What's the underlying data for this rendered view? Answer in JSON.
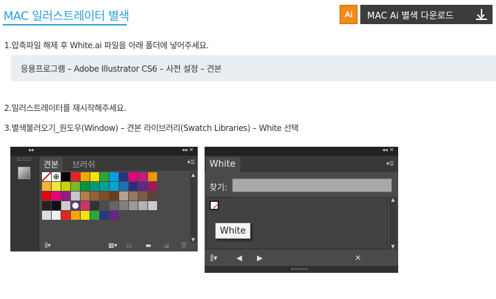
{
  "header": {
    "title": "MAC 일러스트레이터 별색",
    "download_badge": "Ai",
    "download_label": "MAC Ai 별색 다운로드"
  },
  "steps": {
    "step1": "1.압축파일 해제 후 White.ai 파일을 아래 폴더에 넣어주세요.",
    "path": "응용프로그램 – Adobe Illustrator CS6 – 사전 설정 – 견본",
    "step2": "2.일러스트레이터를 재시작해주세요.",
    "step3": "3.별색불러오기_원도우(Window) – 견본 라이브러리(Swatch Libraries) – White 선택"
  },
  "swatch_panel": {
    "tab_active": "견본",
    "tab_inactive": "브러쉬",
    "swatch_rows": [
      [
        "#ffffff",
        "#ffffff",
        "#000000",
        "#e52421",
        "#f7a600",
        "#f5e400",
        "#28a935",
        "#00a0e3",
        "#283583",
        "#e6007e",
        "#c6197e",
        "#f39200"
      ],
      [
        "#f9b233",
        "#ece935",
        "#c8d400",
        "#7ab929",
        "#00963f",
        "#009b79",
        "#00a19a",
        "#00a6ce",
        "#1d71b8",
        "#2b2d83",
        "#662483",
        "#a2195b"
      ],
      [
        "#e30613",
        "#e5007d",
        "#951b81",
        "#c6c6c6",
        "#b17f4a",
        "#936037",
        "#7f4b28",
        "#6b3c1f",
        "#b6a28c",
        "#967760",
        "#7a5d45",
        "#5d4333"
      ],
      [
        "#222222",
        "#111111",
        "#cccccc",
        "#ffffff",
        "#cc3366",
        "#333333",
        "#4d4d4d",
        "#666666",
        "#808080",
        "#999999",
        "#b3b3b3",
        "#cccccc"
      ],
      [
        "#dddddd",
        "#eeeeee",
        "#e52421",
        "#f7a600",
        "#f5e400",
        "#28a935",
        "#283583",
        "#662483"
      ]
    ]
  },
  "white_panel": {
    "tab": "White",
    "find_label": "찾기:",
    "find_value": "",
    "tooltip": "White"
  }
}
